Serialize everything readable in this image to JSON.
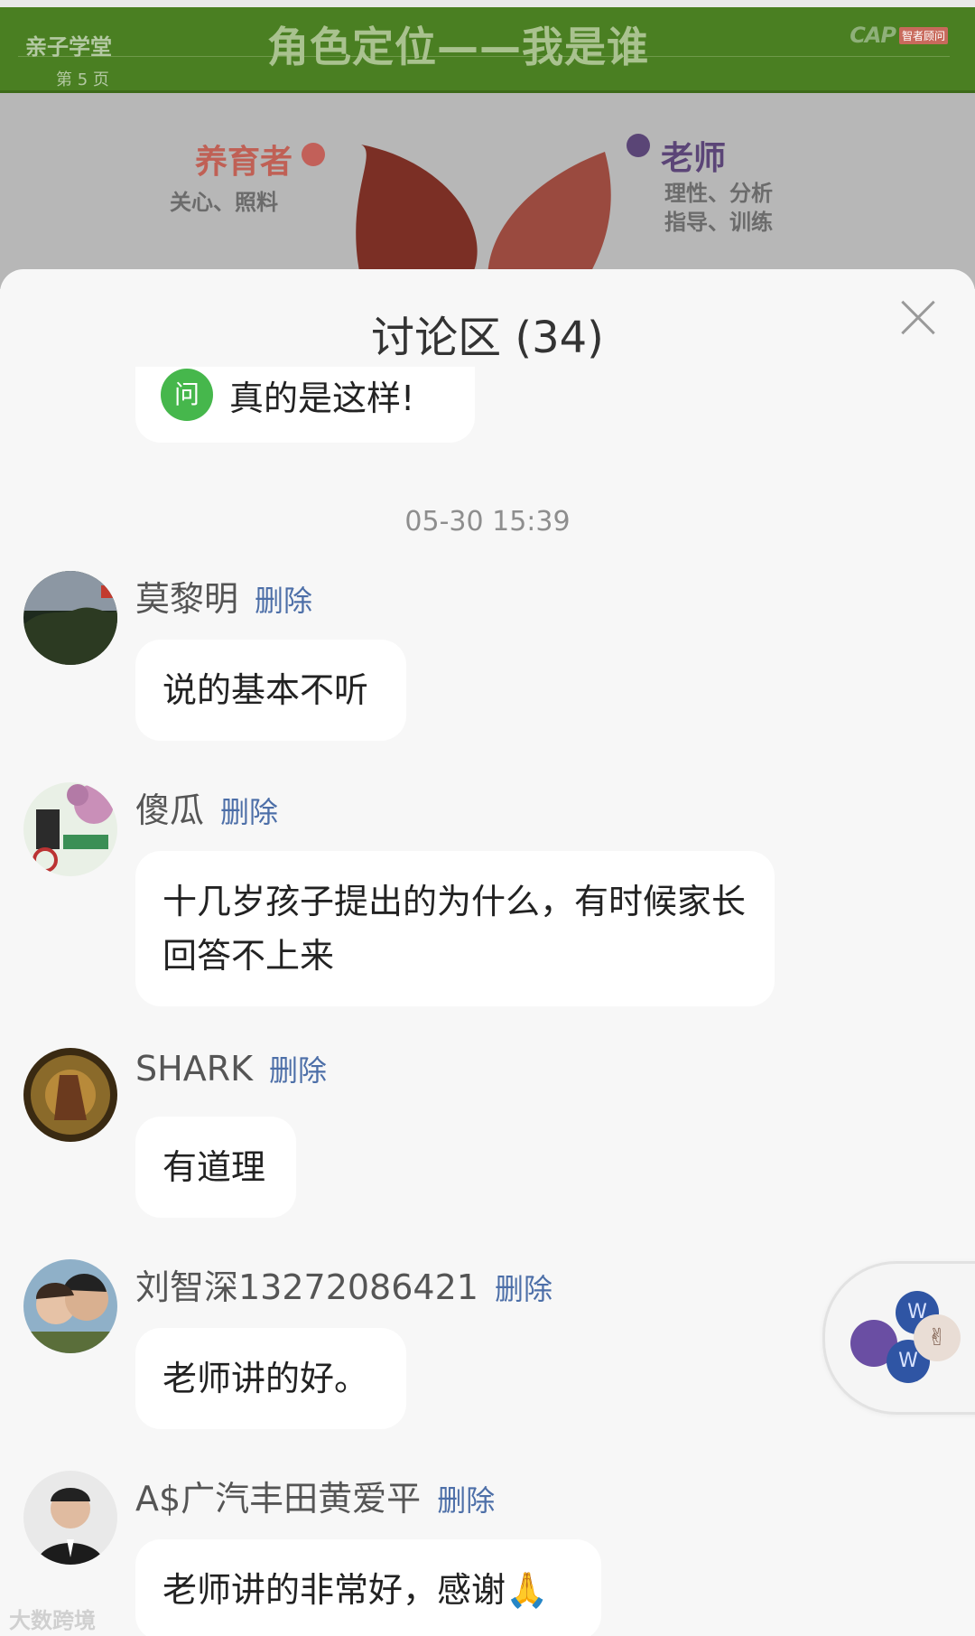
{
  "slide": {
    "course_name": "亲子学堂",
    "page_number": "第 5 页",
    "title": "角色定位——我是谁",
    "logo_text": "CAP",
    "logo_tag": "智者顾问",
    "left_role": {
      "title": "养育者",
      "desc": "关心、照料"
    },
    "right_role": {
      "title": "老师",
      "desc": "理性、分析\n指导、训练"
    },
    "colors": {
      "header_green": "#4a7f22",
      "left_role": "#c06055",
      "right_role": "#5b4577"
    }
  },
  "discussion": {
    "title": "讨论区 (34)",
    "close_icon": "close-icon",
    "previous_message": {
      "badge": "问",
      "text": "真的是这样!"
    },
    "timestamp": "05-30 15:39",
    "delete_label": "删除",
    "messages": [
      {
        "name": "莫黎明",
        "text": "说的基本不听"
      },
      {
        "name": "傻瓜",
        "text": "十几岁孩子提出的为什么，有时候家长回答不上来"
      },
      {
        "name": "SHARK",
        "text": "有道理"
      },
      {
        "name": "刘智深13272086421",
        "text": "老师讲的好。"
      },
      {
        "name": "A$广汽丰田黄爱平",
        "text": "老师讲的非常好，感谢🙏"
      }
    ]
  },
  "floating_widget": {
    "w1": "W",
    "w2": "W",
    "hand": "✌"
  },
  "watermark": "大数跨境"
}
